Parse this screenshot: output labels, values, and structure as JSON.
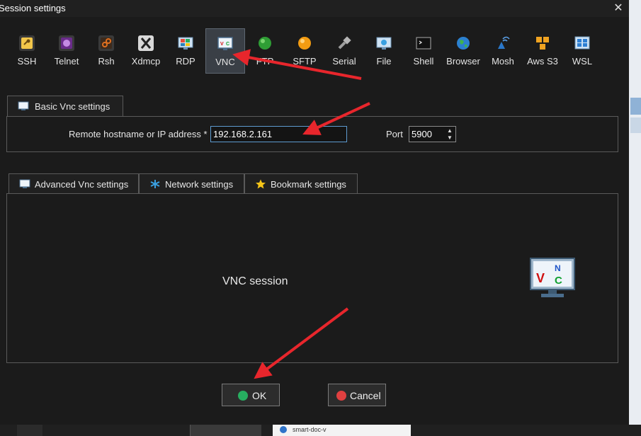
{
  "window": {
    "title": "Session settings",
    "close_glyph": "✕"
  },
  "toolbar": {
    "items": [
      {
        "label": "SSH",
        "icon": "key-icon",
        "color": "#e5b53a"
      },
      {
        "label": "Telnet",
        "icon": "telnet-icon",
        "color": "#8e44ad"
      },
      {
        "label": "Rsh",
        "icon": "rsh-icon",
        "color": "#d35400"
      },
      {
        "label": "Xdmcp",
        "icon": "xdmcp-icon",
        "color": "#bdbdbd"
      },
      {
        "label": "RDP",
        "icon": "rdp-icon",
        "color": "#3a8fd8"
      },
      {
        "label": "VNC",
        "icon": "vnc-icon",
        "color": "#dfe9f3"
      },
      {
        "label": "FTP",
        "icon": "ftp-icon",
        "color": "#3fa53a"
      },
      {
        "label": "SFTP",
        "icon": "sftp-icon",
        "color": "#f39c12"
      },
      {
        "label": "Serial",
        "icon": "serial-icon",
        "color": "#9e9e9e"
      },
      {
        "label": "File",
        "icon": "file-icon",
        "color": "#7fb2e0"
      },
      {
        "label": "Shell",
        "icon": "shell-icon",
        "color": "#2b2b2b"
      },
      {
        "label": "Browser",
        "icon": "browser-icon",
        "color": "#2e9d4b"
      },
      {
        "label": "Mosh",
        "icon": "mosh-icon",
        "color": "#2a77c9"
      },
      {
        "label": "Aws S3",
        "icon": "aws-s3-icon",
        "color": "#f0a321"
      },
      {
        "label": "WSL",
        "icon": "wsl-icon",
        "color": "#2d7fd3"
      }
    ],
    "selected": "VNC"
  },
  "basic": {
    "tab_label": "Basic Vnc settings",
    "host_label": "Remote hostname or IP address *",
    "host_value": "192.168.2.161",
    "port_label": "Port",
    "port_value": "5900"
  },
  "tabs": [
    {
      "label": "Advanced Vnc settings",
      "icon": "vnc-icon"
    },
    {
      "label": "Network settings",
      "icon": "network-icon"
    },
    {
      "label": "Bookmark settings",
      "icon": "star-icon"
    }
  ],
  "panel": {
    "session_label": "VNC session",
    "monitor_letters": [
      "V",
      "N",
      "C"
    ]
  },
  "buttons": {
    "ok": "OK",
    "cancel": "Cancel"
  },
  "background": {
    "taskbar_item": "smart-doc-v"
  },
  "colors": {
    "accent": "#5e9bd0",
    "arrow": "#e8262c",
    "ok": "#27ae60",
    "cancel": "#e04040"
  }
}
